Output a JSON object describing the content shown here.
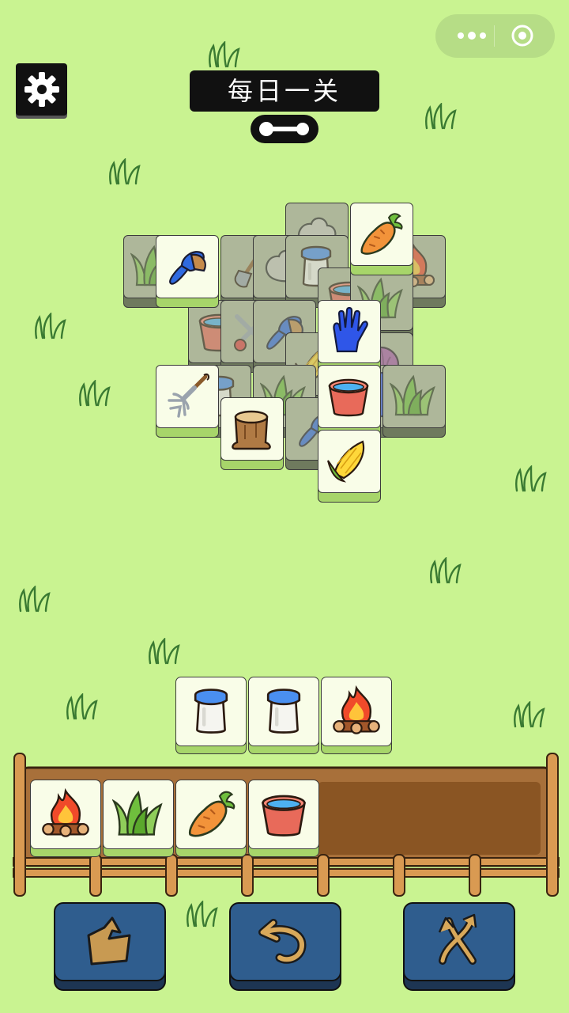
{
  "header": {
    "title": "每日一关",
    "settings_icon": "gear-icon",
    "miniapp_menu_icon": "more-dots-icon",
    "miniapp_close_icon": "target-circle-icon"
  },
  "colors": {
    "background": "#c9f391",
    "tile_face": "#f9fde8",
    "tile_base": "#a7d56a",
    "tray_wood": "#a8703a",
    "tool_button": "#2f5d8e"
  },
  "board": {
    "tiles": [
      {
        "icon": "stone-icon",
        "state": "covered"
      },
      {
        "icon": "carrot-icon",
        "state": "free"
      },
      {
        "icon": "grass-icon",
        "state": "covered"
      },
      {
        "icon": "brush-icon",
        "state": "free"
      },
      {
        "icon": "shovel-icon",
        "state": "covered"
      },
      {
        "icon": "stone-icon",
        "state": "covered"
      },
      {
        "icon": "milk-jar-icon",
        "state": "covered"
      },
      {
        "icon": "campfire-icon",
        "state": "covered"
      },
      {
        "icon": "water-bucket-icon",
        "state": "covered"
      },
      {
        "icon": "grass-icon",
        "state": "covered"
      },
      {
        "icon": "water-bucket-icon",
        "state": "covered"
      },
      {
        "icon": "shears-icon",
        "state": "covered"
      },
      {
        "icon": "brush-icon",
        "state": "covered"
      },
      {
        "icon": "glove-icon",
        "state": "free"
      },
      {
        "icon": "corn-icon",
        "state": "covered"
      },
      {
        "icon": "cabbage-icon",
        "state": "covered"
      },
      {
        "icon": "pitchfork-icon",
        "state": "free"
      },
      {
        "icon": "milk-jar-icon",
        "state": "covered"
      },
      {
        "icon": "grass-icon",
        "state": "covered"
      },
      {
        "icon": "water-bucket-icon",
        "state": "free"
      },
      {
        "icon": "glove-icon",
        "state": "covered"
      },
      {
        "icon": "grass-icon",
        "state": "covered"
      },
      {
        "icon": "tree-stump-icon",
        "state": "free"
      },
      {
        "icon": "brush-icon",
        "state": "covered"
      },
      {
        "icon": "corn-icon",
        "state": "free"
      }
    ]
  },
  "staging_tiles": [
    "milk-jar-icon",
    "milk-jar-icon",
    "campfire-icon"
  ],
  "tray": {
    "capacity": 7,
    "filled": [
      "campfire-icon",
      "grass-icon",
      "carrot-icon",
      "water-bucket-icon"
    ]
  },
  "tools": [
    {
      "name": "move-out",
      "icon": "tile-lift-icon"
    },
    {
      "name": "undo",
      "icon": "undo-icon"
    },
    {
      "name": "shuffle",
      "icon": "shuffle-icon"
    }
  ]
}
